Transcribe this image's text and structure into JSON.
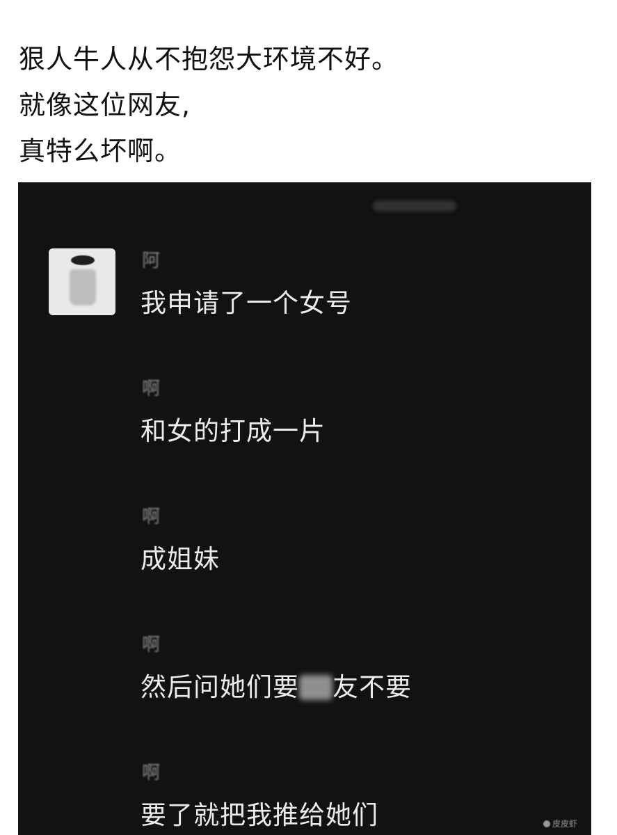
{
  "caption": {
    "lines": [
      "狠人牛人从不抱怨大环境不好。",
      "就像这位网友,",
      "真特么坏啊。"
    ]
  },
  "chat": {
    "messages": [
      {
        "name": "阿",
        "text": "我申请了一个女号"
      },
      {
        "name": "啊",
        "text": "和女的打成一片"
      },
      {
        "name": "啊",
        "text": "成姐妹"
      },
      {
        "name": "啊",
        "text_before": "然后问她们要",
        "text_after": "友不要"
      },
      {
        "name": "啊",
        "text": "要了就把我推给她们"
      }
    ]
  },
  "watermark": {
    "text": "皮皮虾"
  }
}
